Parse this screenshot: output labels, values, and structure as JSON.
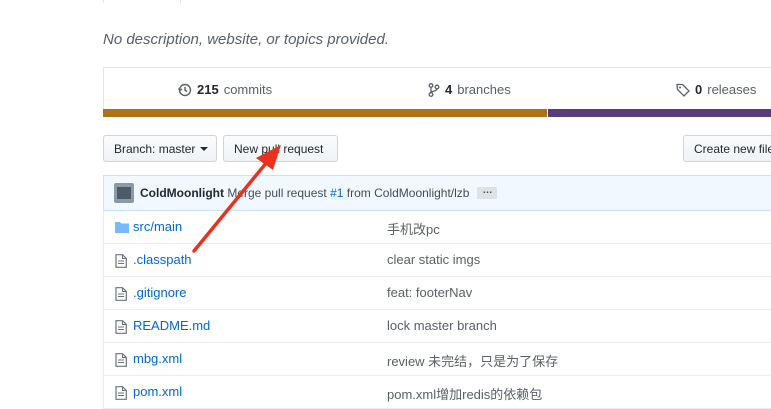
{
  "repo": {
    "description": "No description, website, or topics provided."
  },
  "numbers_summary": {
    "commits_count": "215",
    "commits_label": "commits",
    "branches_count": "4",
    "branches_label": "branches",
    "releases_count": "0",
    "releases_label": "releases"
  },
  "language_bar": {
    "segments": [
      {
        "color": "#b07219",
        "share": 0.645
      },
      {
        "color": "#563d7c",
        "share": 0.355
      }
    ]
  },
  "toolbar": {
    "branch_prefix": "Branch:",
    "branch_name": "master",
    "new_pull_request_label": "New pull request",
    "create_new_file_label": "Create new file"
  },
  "latest_commit": {
    "author": "ColdMoonlight",
    "message_prefix": "Merge pull request",
    "pr_link": "#1",
    "message_suffix": "from ColdMoonlight/lzb",
    "ellipsis": "…"
  },
  "files": [
    {
      "name": "src/main",
      "type": "folder",
      "message": "手机改pc"
    },
    {
      "name": ".classpath",
      "type": "file",
      "message": "clear static imgs"
    },
    {
      "name": ".gitignore",
      "type": "file",
      "message": "feat: footerNav"
    },
    {
      "name": "README.md",
      "type": "file",
      "message": "lock master branch"
    },
    {
      "name": "mbg.xml",
      "type": "file",
      "message": "review 未完结，只是为了保存"
    },
    {
      "name": "pom.xml",
      "type": "file",
      "message": "pom.xml增加redis的依赖包"
    }
  ],
  "annotation": {
    "arrow_color": "#e8321e"
  }
}
